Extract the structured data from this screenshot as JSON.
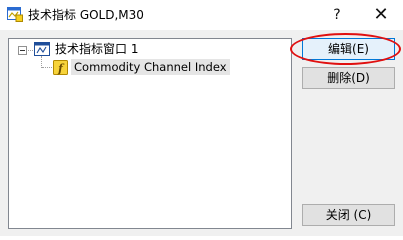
{
  "window": {
    "title": "技术指标 GOLD,M30",
    "help_label": "?",
    "close_label": "✕"
  },
  "tree": {
    "root": {
      "label": "技术指标窗口 1",
      "expanded": true,
      "icon": "indicator-window-icon"
    },
    "children": [
      {
        "label": "Commodity Channel Index",
        "icon": "custom-indicator-icon",
        "selected": true
      }
    ]
  },
  "buttons": {
    "edit": "编辑(E)",
    "delete": "删除(D)",
    "close": "关闭 (C)"
  },
  "colors": {
    "highlight_ring": "#e01010",
    "focus_border": "#0078d7",
    "selection": "#e5e5e5"
  }
}
